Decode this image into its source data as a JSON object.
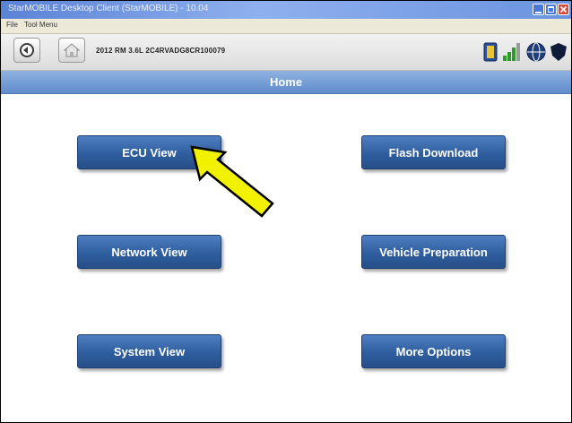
{
  "window": {
    "title": "StarMOBILE Desktop Client (StarMOBILE) - 10.04",
    "minimize_icon": "minimize-icon",
    "maximize_icon": "maximize-icon",
    "close_icon": "close-icon"
  },
  "menu": {
    "items": [
      "File",
      "Tool Menu"
    ]
  },
  "toolbar": {
    "back_icon": "back-icon",
    "home_icon": "home-icon",
    "vehicle_info": "2012  RM  3.6L  2C4RVADG8CR100079",
    "status_icons": [
      "battery-icon",
      "signal-icon",
      "network-icon",
      "shield-icon"
    ]
  },
  "header": {
    "title": "Home"
  },
  "buttons": {
    "ecu_view": "ECU View",
    "flash_download": "Flash Download",
    "network_view": "Network View",
    "vehicle_preparation": "Vehicle Preparation",
    "system_view": "System View",
    "more_options": "More Options"
  },
  "annotation": {
    "arrow_icon": "pointer-arrow-icon",
    "arrow_color": "#f2f200"
  },
  "colors": {
    "title_bar": "#6b93e0",
    "header_bar": "#7aa0d8",
    "button": "#2f5e9f",
    "button_text": "#ffffff"
  }
}
